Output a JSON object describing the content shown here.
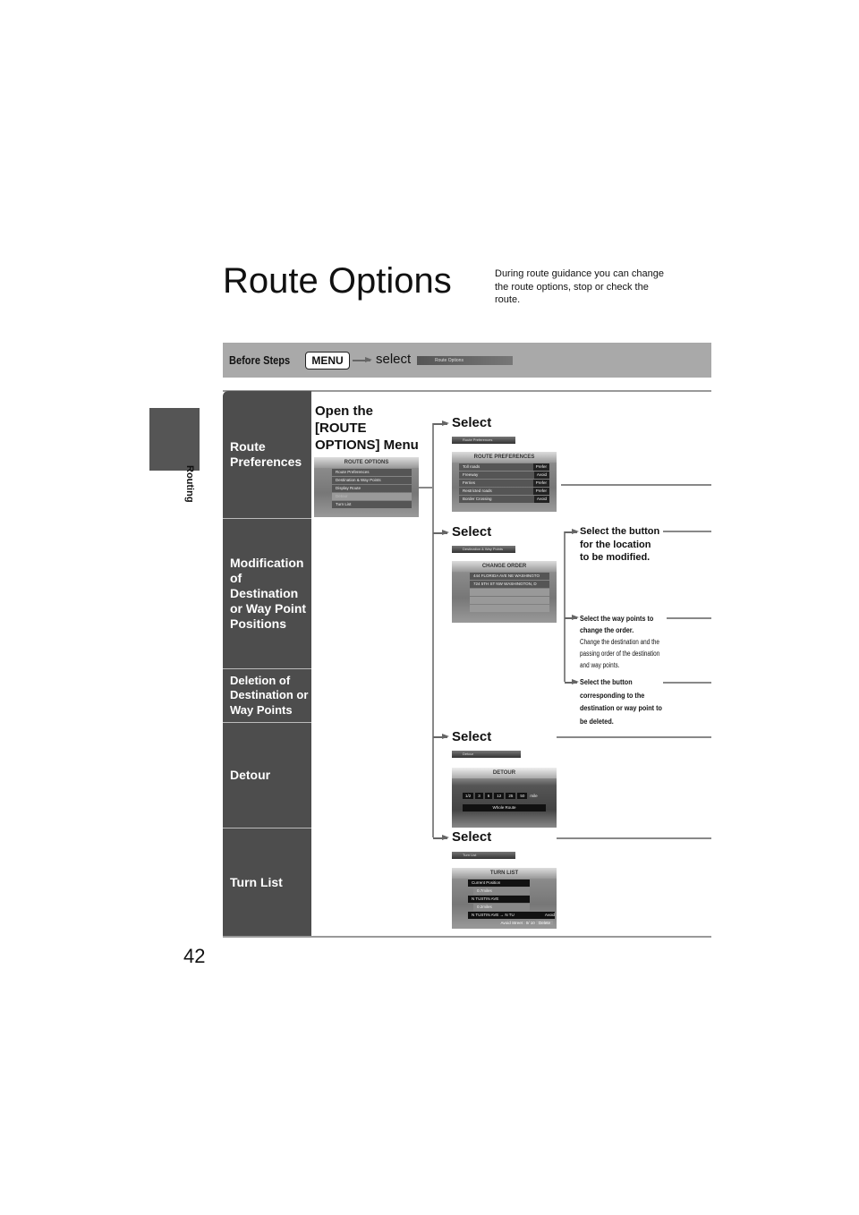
{
  "side_tab": {
    "label": "Routing"
  },
  "page_number": "42",
  "title": "Route Options",
  "intro": "During route guidance you can change the route options, stop or check the route.",
  "before_steps": {
    "label": "Before Steps",
    "menu_key": "MENU",
    "select": "select",
    "chip": "Route Options"
  },
  "rows": [
    {
      "label": "Route Preferences"
    },
    {
      "label": "Modification of Destination or Way Point Positions"
    },
    {
      "label": "Deletion of Destination or Way Points"
    },
    {
      "label": "Detour"
    },
    {
      "label": "Turn List"
    }
  ],
  "open_menu": {
    "text": "Open the [ROUTE OPTIONS] Menu",
    "screen_title": "ROUTE OPTIONS",
    "items": [
      "Route Preferences",
      "Destination & Way Points",
      "Display Route",
      "Detour",
      "Turn List"
    ]
  },
  "select_label": "Select",
  "route_prefs": {
    "chip": "Route Preferences",
    "screen_title": "ROUTE PREFERENCES",
    "items": [
      "Toll roads",
      "Freeway",
      "Ferries",
      "Restricted roads",
      "Border Crossing"
    ],
    "prefer": "Prefer",
    "avoid": "Avoid"
  },
  "change_order": {
    "chip": "Destination & Way Points",
    "screen_title": "CHANGE ORDER",
    "items": [
      "444 FLORIDA AVE NE WASHINGTO",
      "724 5TH ST NW WASHINGTON, D"
    ]
  },
  "notes": {
    "n1": "Select the button for the location to be modified.",
    "n2_bold": "Select the way points to change the order.",
    "n2_small": "Change the destination and the passing order of the destination and way points.",
    "n3": "Select the button corresponding to the destination or way point to be deleted."
  },
  "detour": {
    "chip": "Detour",
    "screen_title": "DETOUR",
    "distances": [
      "1/2",
      "3",
      "6",
      "12",
      "25",
      "50"
    ],
    "unit": "mile",
    "whole": "Whole Route"
  },
  "turn_list": {
    "chip": "Turn List",
    "screen_title": "TURN LIST",
    "items": [
      "Current Position",
      "0.7miles",
      "N TUSTIN AVE",
      "0.2miles",
      "N TUSTIN AVE → N TU"
    ],
    "avoid": "Avoid",
    "footer": "Avoid Street : 0/ 10",
    "delete": "Delete"
  }
}
